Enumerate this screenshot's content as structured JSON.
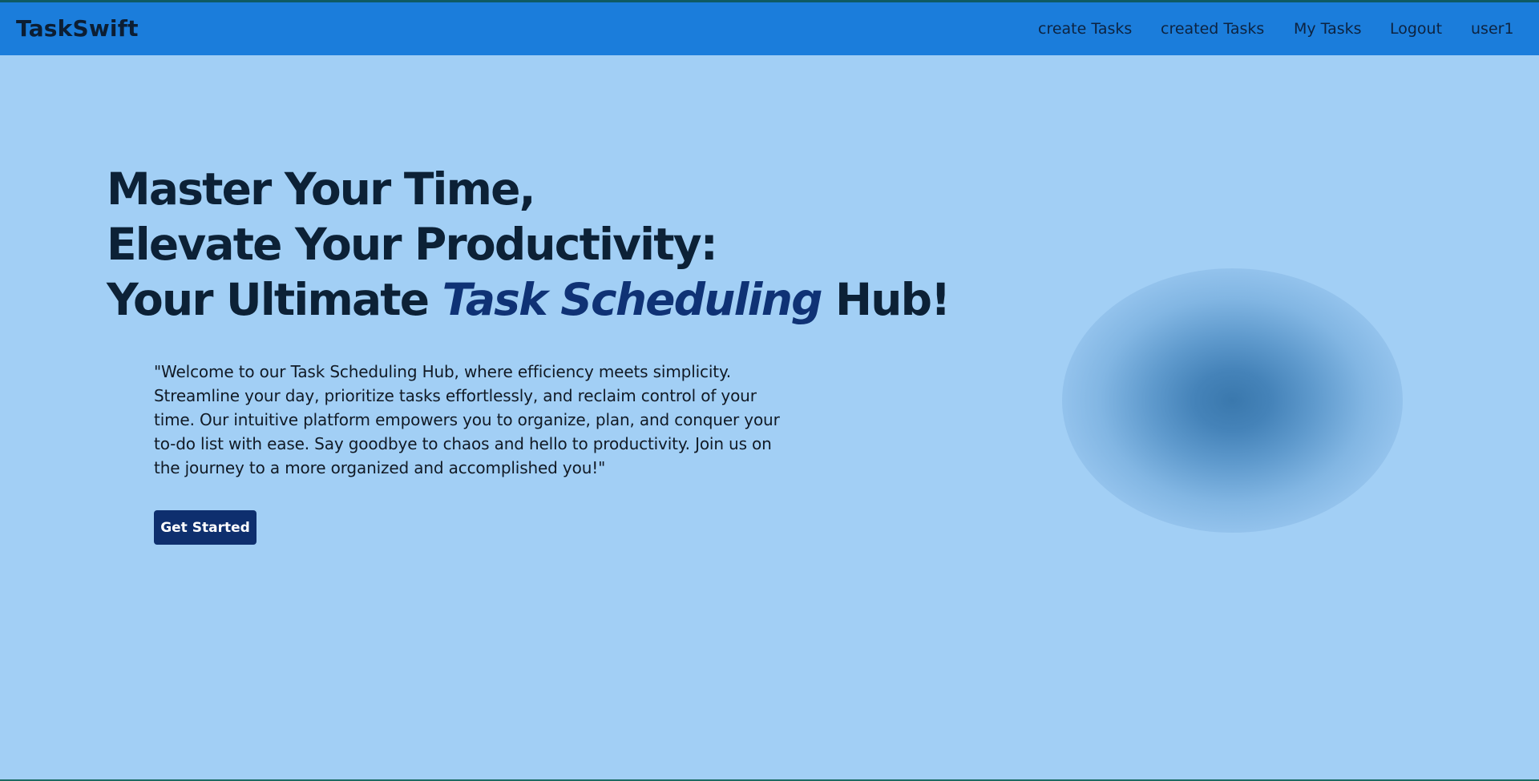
{
  "header": {
    "brand": "TaskSwift",
    "nav": [
      {
        "label": "create Tasks"
      },
      {
        "label": "created Tasks"
      },
      {
        "label": "My Tasks"
      },
      {
        "label": "Logout"
      },
      {
        "label": "user1"
      }
    ]
  },
  "hero": {
    "line1": "Master Your Time,",
    "line2": "Elevate Your Productivity:",
    "line3_prefix": "Your Ultimate",
    "line3_accent": "Task Scheduling",
    "line3_suffix": "Hub!",
    "description": "\"Welcome to our Task Scheduling Hub, where efficiency meets simplicity. Streamline your day, prioritize tasks effortlessly, and reclaim control of your time. Our intuitive platform empowers you to organize, plan, and conquer your to-do list with ease. Say goodbye to chaos and hello to productivity. Join us on the journey to a more organized and accomplished you!\"",
    "cta_label": "Get Started"
  },
  "colors": {
    "navbar": "#1b7ddb",
    "page_background": "#a2cff5",
    "heading": "#0c2136",
    "accent": "#0f3275",
    "button": "#0e2f6e"
  }
}
